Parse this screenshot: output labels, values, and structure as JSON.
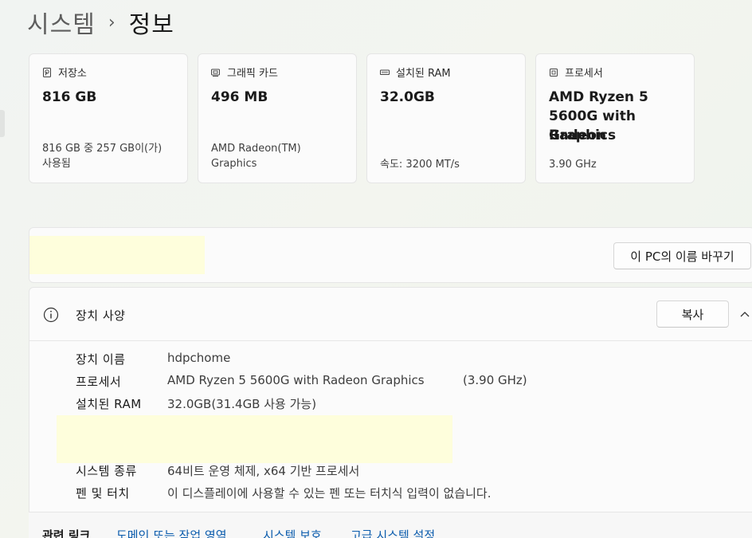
{
  "breadcrumb": {
    "parent": "시스템",
    "separator": "›",
    "current": "정보"
  },
  "cards": {
    "storage": {
      "title": "저장소",
      "value": "816 GB",
      "sub_line1": "816 GB 중 257 GB이(가)",
      "sub_line2": "사용됨",
      "icon": "hard-drive-icon"
    },
    "graphics": {
      "title": "그래픽 카드",
      "value": "496 MB",
      "sub_line1": "AMD Radeon(TM)",
      "sub_line2": "Graphics",
      "icon": "display-adapter-icon"
    },
    "ram": {
      "title": "설치된 RAM",
      "value": "32.0GB",
      "sub_line1": "속도: 3200 MT/s",
      "icon": "memory-icon"
    },
    "processor": {
      "title": "프로세서",
      "value_line1": "AMD Ryzen 5",
      "value_line2": "5600G with Radeon",
      "value_line3": "Graphics",
      "sub_line1": "3.90 GHz",
      "icon": "cpu-icon"
    }
  },
  "rename": {
    "button_label": "이 PC의 이름 바꾸기"
  },
  "specs": {
    "title": "장치 사양",
    "copy_label": "복사",
    "rows": [
      {
        "label": "장치 이름",
        "value": "hdpchome"
      },
      {
        "label": "프로세서",
        "value": "AMD Ryzen 5 5600G with Radeon Graphics",
        "extra": "(3.90 GHz)"
      },
      {
        "label": "설치된 RAM",
        "value": "32.0GB(31.4GB 사용 가능)"
      },
      {
        "label": "시스템 종류",
        "value": "64비트 운영 체제, x64 기반 프로세서"
      },
      {
        "label": "펜 및 터치",
        "value": "이 디스플레이에 사용할 수 있는 펜 또는 터치식 입력이 없습니다."
      }
    ]
  },
  "related": {
    "title": "관련 링크",
    "links": [
      "도메인 또는 작업 영역",
      "시스템 보호",
      "고급 시스템 설정"
    ]
  },
  "colors": {
    "accent_link": "#0b5cad",
    "highlight": "#fefedc"
  }
}
